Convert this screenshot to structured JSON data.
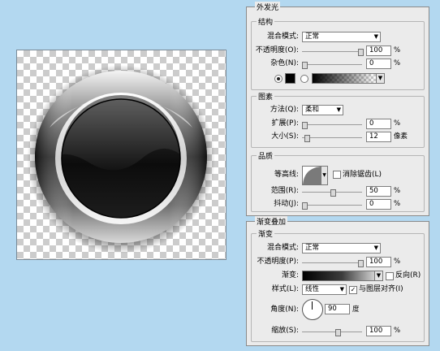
{
  "outer_glow": {
    "title": "外发光",
    "structure": {
      "title": "结构",
      "blend_mode_label": "混合模式:",
      "blend_mode_value": "正常",
      "opacity_label": "不透明度(O):",
      "opacity_value": "100",
      "opacity_unit": "%",
      "noise_label": "杂色(N):",
      "noise_value": "0",
      "noise_unit": "%",
      "swatch_color": "#000000"
    },
    "elements": {
      "title": "图素",
      "technique_label": "方法(Q):",
      "technique_value": "柔和",
      "spread_label": "扩展(P):",
      "spread_value": "0",
      "spread_unit": "%",
      "size_label": "大小(S):",
      "size_value": "12",
      "size_unit": "像素"
    },
    "quality": {
      "title": "品质",
      "contour_label": "等高线:",
      "antialias_label": "消除锯齿(L)",
      "range_label": "范围(R):",
      "range_value": "50",
      "range_unit": "%",
      "jitter_label": "抖动(J):",
      "jitter_value": "0",
      "jitter_unit": "%"
    }
  },
  "gradient_overlay": {
    "title": "渐变叠加",
    "gradient_group_title": "渐变",
    "blend_mode_label": "混合模式:",
    "blend_mode_value": "正常",
    "opacity_label": "不透明度(P):",
    "opacity_value": "100",
    "opacity_unit": "%",
    "gradient_label": "渐变:",
    "reverse_label": "反向(R)",
    "style_label": "样式(L):",
    "style_value": "线性",
    "align_label": "与图层对齐(I)",
    "angle_label": "角度(N):",
    "angle_value": "90",
    "angle_unit": "度",
    "scale_label": "缩放(S):",
    "scale_value": "100",
    "scale_unit": "%"
  }
}
